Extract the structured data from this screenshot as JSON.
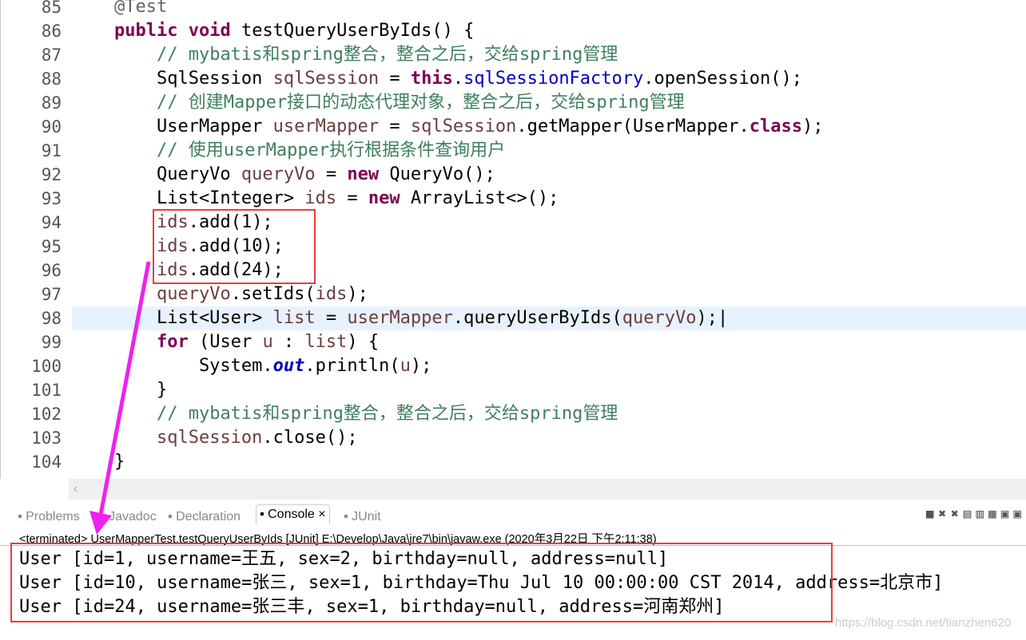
{
  "editor": {
    "lines": [
      {
        "n": "85",
        "tok": [
          [
            "    ",
            ""
          ],
          [
            "@Test",
            "an"
          ]
        ]
      },
      {
        "n": "86",
        "tok": [
          [
            "    ",
            ""
          ],
          [
            "public",
            "kw"
          ],
          [
            " ",
            ""
          ],
          [
            "void",
            "kw"
          ],
          [
            " testQueryUserByIds() {",
            ""
          ]
        ]
      },
      {
        "n": "87",
        "tok": [
          [
            "        ",
            ""
          ],
          [
            "// mybatis和spring整合，整合之后，交给spring管理",
            "cm"
          ]
        ]
      },
      {
        "n": "88",
        "tok": [
          [
            "        SqlSession ",
            ""
          ],
          [
            "sqlSession",
            "lv"
          ],
          [
            " = ",
            ""
          ],
          [
            "this",
            "kw"
          ],
          [
            ".",
            ""
          ],
          [
            "sqlSessionFactory",
            "fd"
          ],
          [
            ".openSession();",
            ""
          ]
        ]
      },
      {
        "n": "89",
        "tok": [
          [
            "        ",
            ""
          ],
          [
            "// 创建Mapper接口的动态代理对象，整合之后，交给spring管理",
            "cm"
          ]
        ]
      },
      {
        "n": "90",
        "tok": [
          [
            "        UserMapper ",
            ""
          ],
          [
            "userMapper",
            "lv"
          ],
          [
            " = ",
            ""
          ],
          [
            "sqlSession",
            "lv"
          ],
          [
            ".getMapper(UserMapper.",
            ""
          ],
          [
            "class",
            "kw"
          ],
          [
            ");",
            ""
          ]
        ]
      },
      {
        "n": "91",
        "tok": [
          [
            "        ",
            ""
          ],
          [
            "// 使用userMapper执行根据条件查询用户",
            "cm"
          ]
        ]
      },
      {
        "n": "92",
        "tok": [
          [
            "        QueryVo ",
            ""
          ],
          [
            "queryVo",
            "lv"
          ],
          [
            " = ",
            ""
          ],
          [
            "new",
            "kw"
          ],
          [
            " QueryVo();",
            ""
          ]
        ]
      },
      {
        "n": "93",
        "tok": [
          [
            "        List<Integer> ",
            ""
          ],
          [
            "ids",
            "lv"
          ],
          [
            " = ",
            ""
          ],
          [
            "new",
            "kw"
          ],
          [
            " ArrayList<>();",
            ""
          ]
        ]
      },
      {
        "n": "94",
        "tok": [
          [
            "        ",
            ""
          ],
          [
            "ids",
            "lv"
          ],
          [
            ".add(1);",
            ""
          ]
        ]
      },
      {
        "n": "95",
        "tok": [
          [
            "        ",
            ""
          ],
          [
            "ids",
            "lv"
          ],
          [
            ".add(10);",
            ""
          ]
        ]
      },
      {
        "n": "96",
        "tok": [
          [
            "        ",
            ""
          ],
          [
            "ids",
            "lv"
          ],
          [
            ".add(24);",
            ""
          ]
        ]
      },
      {
        "n": "97",
        "tok": [
          [
            "        ",
            ""
          ],
          [
            "queryVo",
            "lv"
          ],
          [
            ".setIds(",
            ""
          ],
          [
            "ids",
            "lv"
          ],
          [
            ");",
            ""
          ]
        ]
      },
      {
        "n": "98",
        "tok": [
          [
            "        List<User> ",
            ""
          ],
          [
            "list",
            "lv"
          ],
          [
            " = ",
            ""
          ],
          [
            "userMapper",
            "lv"
          ],
          [
            ".queryUserByIds(",
            ""
          ],
          [
            "queryVo",
            "lv"
          ],
          [
            ");|",
            ""
          ]
        ]
      },
      {
        "n": "99",
        "tok": [
          [
            "        ",
            ""
          ],
          [
            "for",
            "kw"
          ],
          [
            " (User ",
            ""
          ],
          [
            "u",
            "lv"
          ],
          [
            " : ",
            ""
          ],
          [
            "list",
            "lv"
          ],
          [
            ") {",
            ""
          ]
        ]
      },
      {
        "n": "100",
        "tok": [
          [
            "            System.",
            ""
          ],
          [
            "out",
            "fs"
          ],
          [
            ".println(",
            ""
          ],
          [
            "u",
            "lv"
          ],
          [
            ");",
            ""
          ]
        ]
      },
      {
        "n": "101",
        "tok": [
          [
            "        }",
            ""
          ]
        ]
      },
      {
        "n": "102",
        "tok": [
          [
            "        ",
            ""
          ],
          [
            "// mybatis和spring整合，整合之后，交给spring管理",
            "cm"
          ]
        ]
      },
      {
        "n": "103",
        "tok": [
          [
            "        ",
            ""
          ],
          [
            "sqlSession",
            "lv"
          ],
          [
            ".close();",
            ""
          ]
        ]
      },
      {
        "n": "104",
        "tok": [
          [
            "    }",
            ""
          ]
        ]
      }
    ],
    "current_line": "98"
  },
  "tabs": [
    {
      "label": "Problems",
      "icon": "problems-icon"
    },
    {
      "label": "Javadoc",
      "icon": "javadoc-icon"
    },
    {
      "label": "Declaration",
      "icon": "declaration-icon"
    },
    {
      "label": "Console",
      "icon": "console-icon",
      "active": true
    },
    {
      "label": "JUnit",
      "icon": "junit-icon"
    }
  ],
  "console": {
    "status": "<terminated> UserMapperTest.testQueryUserByIds [JUnit] E:\\Develop\\Java\\jre7\\bin\\javaw.exe (2020年3月22日 下午2:11:38)",
    "output": [
      "User [id=1, username=王五, sex=2, birthday=null, address=null]",
      "User [id=10, username=张三, sex=1, birthday=Thu Jul 10 00:00:00 CST 2014, address=北京市]",
      "User [id=24, username=张三丰, sex=1, birthday=null, address=河南郑州]"
    ]
  },
  "watermark": "https://blog.csdn.net/tianzhen620",
  "colors": {
    "highlight": "#f03a3a",
    "arrow": "#ee22ee"
  }
}
